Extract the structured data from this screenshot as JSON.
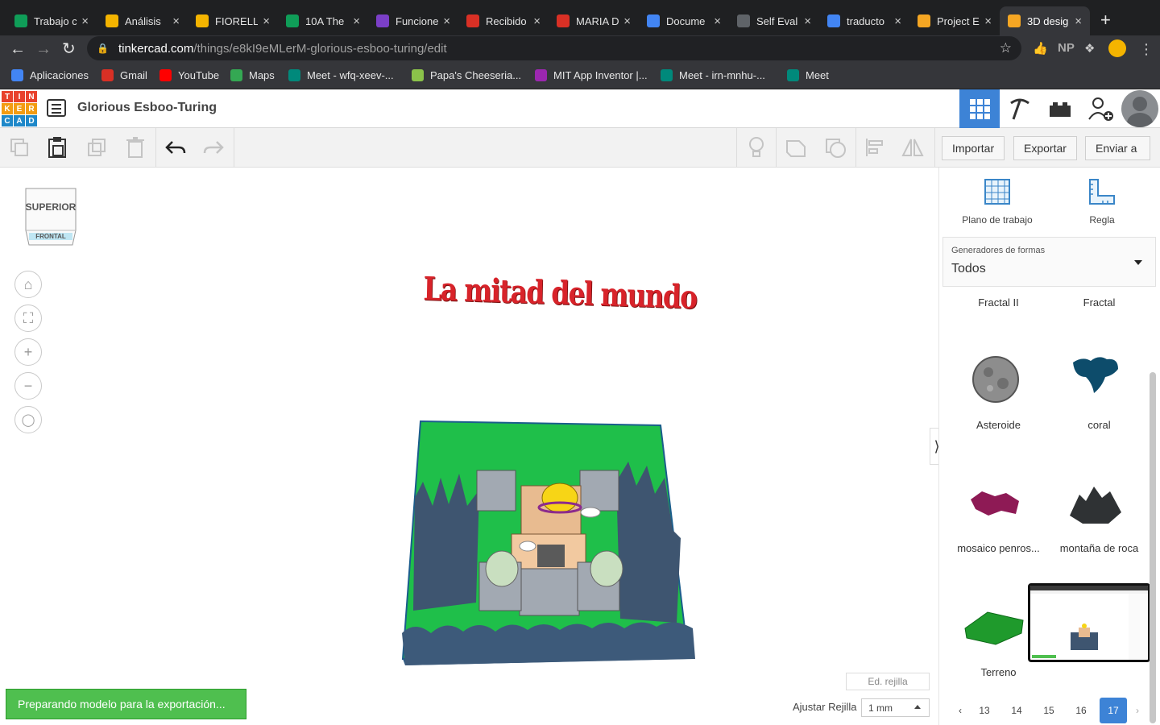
{
  "browser": {
    "tabs": [
      {
        "title": "Trabajo c",
        "favicon_color": "#0f9d58"
      },
      {
        "title": "Análisis",
        "favicon_color": "#f4b400"
      },
      {
        "title": "FIORELL",
        "favicon_color": "#f4b400"
      },
      {
        "title": "10A The",
        "favicon_color": "#0f9d58"
      },
      {
        "title": "Funcione",
        "favicon_color": "#7b3fc7"
      },
      {
        "title": "Recibido",
        "favicon_color": "#d93025"
      },
      {
        "title": "MARIA D",
        "favicon_color": "#d93025"
      },
      {
        "title": "Docume",
        "favicon_color": "#4285f4"
      },
      {
        "title": "Self Eval",
        "favicon_color": "#5f6368"
      },
      {
        "title": "traducto",
        "favicon_color": "#4285f4"
      },
      {
        "title": "Project E",
        "favicon_color": "#f5a623"
      },
      {
        "title": "3D desig",
        "favicon_color": "#f5a623"
      }
    ],
    "address": {
      "host": "tinkercad.com",
      "path": "/things/e8kI9eMLerM-glorious-esboo-turing/edit"
    },
    "bookmarks": [
      {
        "label": "Aplicaciones",
        "icon": "apps-grid-icon",
        "color": "#4285f4"
      },
      {
        "label": "Gmail",
        "icon": "gmail-icon",
        "color": "#d93025"
      },
      {
        "label": "YouTube",
        "icon": "youtube-icon",
        "color": "#ff0000"
      },
      {
        "label": "Maps",
        "icon": "maps-icon",
        "color": "#34a853"
      },
      {
        "label": "Meet - wfq-xeev-...",
        "icon": "meet-icon",
        "color": "#00897b"
      },
      {
        "label": "Papa's Cheeseria...",
        "icon": "papas-icon",
        "color": "#8bc34a"
      },
      {
        "label": "MIT App Inventor |...",
        "icon": "app-inventor-icon",
        "color": "#9c27b0"
      },
      {
        "label": "Meet - irn-mnhu-...",
        "icon": "meet-icon",
        "color": "#00897b"
      },
      {
        "label": "Meet",
        "icon": "meet-icon",
        "color": "#00897b"
      }
    ],
    "extensions": [
      "NP"
    ]
  },
  "app": {
    "logo": [
      "T",
      "I",
      "N",
      "K",
      "E",
      "R",
      "C",
      "A",
      "D"
    ],
    "logo_colors": [
      "#e8412c",
      "#e8412c",
      "#e8412c",
      "#f39c12",
      "#f39c12",
      "#f39c12",
      "#1e88c9",
      "#1e88c9",
      "#1e88c9"
    ],
    "project_title": "Glorious Esboo-Turing",
    "accent": "#3d83d6"
  },
  "toolbar": {
    "import_label": "Importar",
    "export_label": "Exportar",
    "send_label": "Enviar a"
  },
  "viewcube": {
    "top_label": "SUPERIOR",
    "front_label": "FRONTAL"
  },
  "scene": {
    "title_text": "La mitad del mundo"
  },
  "workspace": {
    "status_toast": "Preparando modelo para la exportación...",
    "edit_grid_label": "Ed. rejilla",
    "snap_label": "Ajustar Rejilla",
    "snap_value": "1 mm",
    "status_color": "#4fbf4f"
  },
  "panel": {
    "tools": [
      {
        "label": "Plano de trabajo",
        "icon": "workplane-icon"
      },
      {
        "label": "Regla",
        "icon": "ruler-icon"
      }
    ],
    "generator": {
      "label": "Generadores de formas",
      "value": "Todos"
    },
    "shapes": [
      {
        "label": "Fractal II",
        "color": "#888888"
      },
      {
        "label": "Fractal",
        "color": "#888888"
      },
      {
        "label": "Asteroide",
        "color": "#8d8d8d"
      },
      {
        "label": "coral",
        "color": "#0d4c6b"
      },
      {
        "label": "mosaico penros...",
        "color": "#8e1a55"
      },
      {
        "label": "montaña de roca",
        "color": "#2f3234"
      },
      {
        "label": "Terreno",
        "color": "#1f9a2c"
      }
    ],
    "pages": [
      "13",
      "14",
      "15",
      "16",
      "17"
    ],
    "current_page": "17"
  }
}
